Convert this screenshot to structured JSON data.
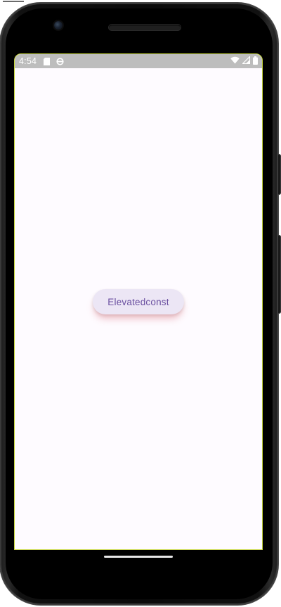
{
  "status_bar": {
    "time": "4:54",
    "left_icons": [
      "sd-card-icon",
      "sync-icon"
    ],
    "right_icons": [
      "wifi-icon",
      "signal-icon",
      "battery-icon"
    ]
  },
  "main": {
    "button_label": "Elevatedconst"
  },
  "colors": {
    "screen_background": "#fefbff",
    "status_bar_background": "#bdbdbd",
    "button_background": "#ece6f5",
    "button_text": "#6a4fa0",
    "button_shadow": "#dc7882",
    "screen_outline": "#c6d63a"
  }
}
